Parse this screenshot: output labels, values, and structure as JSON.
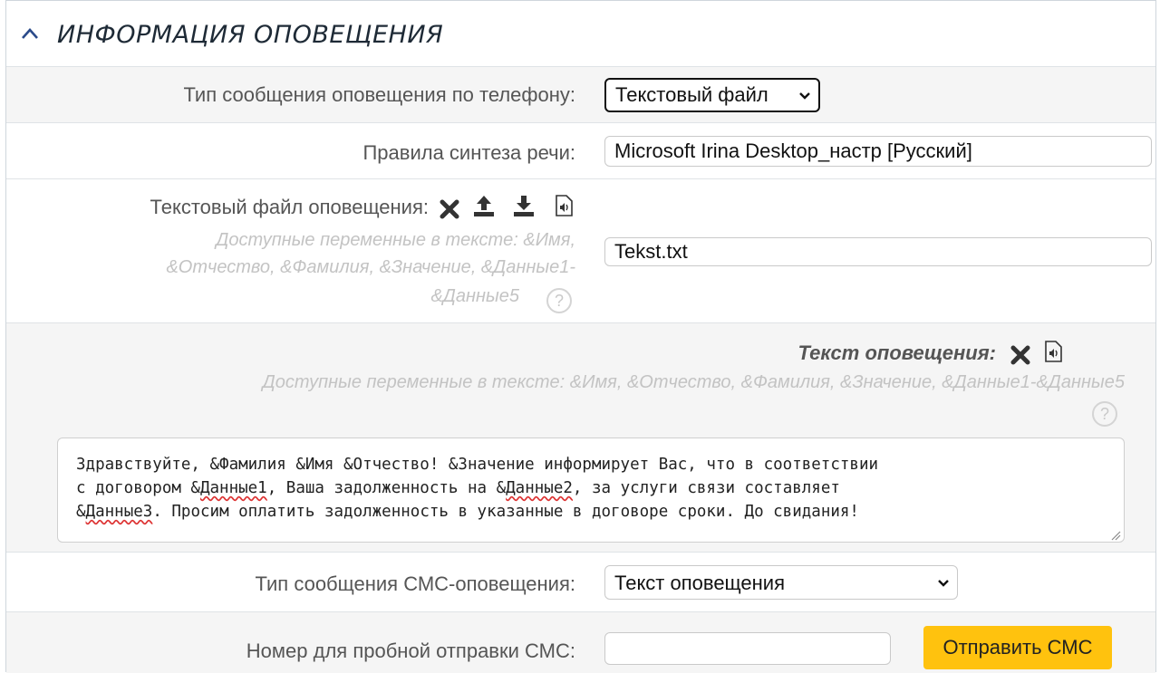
{
  "section": {
    "title": "ИНФОРМАЦИЯ ОПОВЕЩЕНИЯ"
  },
  "phone_type": {
    "label": "Тип сообщения оповещения по телефону:",
    "selected": "Текстовый файл"
  },
  "speech_rules": {
    "label": "Правила синтеза речи:",
    "value": "Microsoft Irina Desktop_настр [Русский]"
  },
  "text_file": {
    "label": "Текстовый файл оповещения:",
    "vars_line1": "Доступные переменные в тексте: &Имя,",
    "vars_line2": "&Отчество, &Фамилия, &Значение, &Данные1-",
    "vars_line3": "&Данные5",
    "help": "?",
    "value": "Tekst.txt",
    "icons": [
      "delete-icon",
      "upload-icon",
      "download-icon",
      "audio-file-icon"
    ]
  },
  "message_text": {
    "label": "Текст оповещения:",
    "vars": "Доступные переменные в тексте: &Имя, &Отчество, &Фамилия, &Значение, &Данные1-&Данные5",
    "help": "?",
    "line1": "Здравствуйте, &Фамилия &Имя &Отчество! &Значение информирует Вас, что в соответствии",
    "line2_a": "с договором &",
    "line2_b": "Данные1",
    "line2_c": ", Ваша задолженность на &",
    "line2_d": "Данные2",
    "line2_e": ", за услуги связи составляет",
    "line3_a": "&",
    "line3_b": "Данные3",
    "line3_c": ". Просим оплатить задолженность в указанные в договоре сроки. До свидания!",
    "icons": [
      "delete-icon",
      "audio-file-icon"
    ]
  },
  "sms_type": {
    "label": "Тип сообщения СМС-оповещения:",
    "selected": "Текст оповещения"
  },
  "sms_test": {
    "label": "Номер для пробной отправки СМС:",
    "value": "",
    "button": "Отправить СМС"
  },
  "colors": {
    "accent_button": "#ffc20e",
    "row_grey": "#f5f5f5",
    "muted_text": "#c3c3c3"
  }
}
